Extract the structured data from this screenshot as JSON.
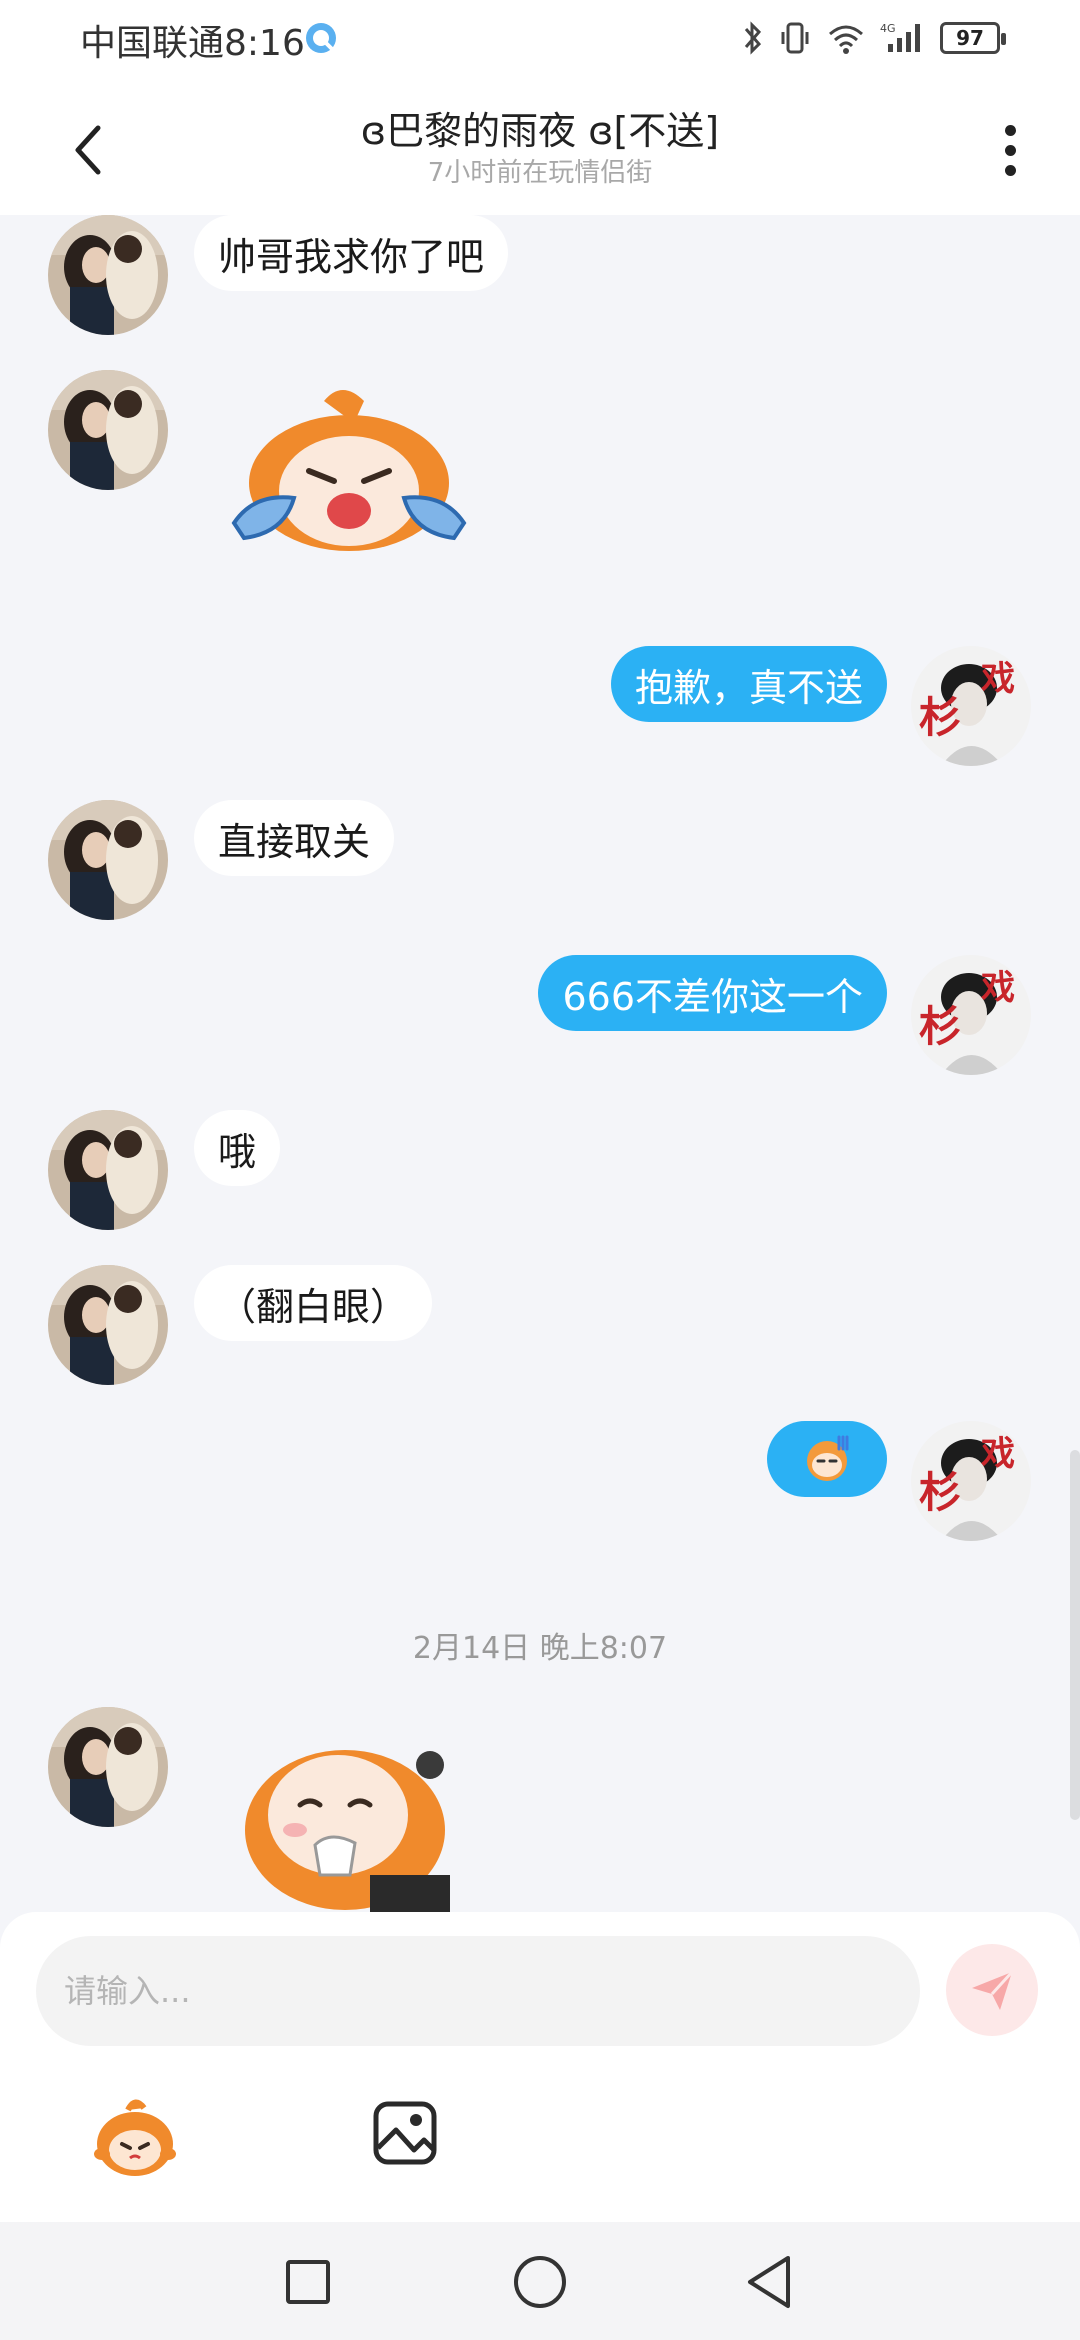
{
  "status_bar": {
    "carrier_time": "中国联通8:16",
    "network": "4G",
    "battery": "97"
  },
  "header": {
    "title": "ɞ巴黎的雨夜 ɞ[不送]",
    "subtitle": "7小时前在玩情侣街"
  },
  "messages": [
    {
      "from": "other",
      "type": "text",
      "text": "帅哥我求你了吧"
    },
    {
      "from": "other",
      "type": "sticker",
      "sticker": "crying-fox-sticker"
    },
    {
      "from": "me",
      "type": "text",
      "text": "抱歉，真不送"
    },
    {
      "from": "other",
      "type": "text",
      "text": "直接取关"
    },
    {
      "from": "me",
      "type": "text",
      "text": "666不差你这一个"
    },
    {
      "from": "other",
      "type": "text",
      "text": "哦"
    },
    {
      "from": "other",
      "type": "text",
      "text": "（翻白眼）"
    },
    {
      "from": "me",
      "type": "emoji",
      "emoji": "face-emoji"
    },
    {
      "from": "other",
      "type": "sticker",
      "sticker": "tissue-fox-sticker"
    }
  ],
  "timestamp": "2月14日 晚上8:07",
  "input": {
    "placeholder": "请输入..."
  },
  "colors": {
    "outgoing_bubble": "#2bb1f4",
    "incoming_bubble": "#ffffff",
    "background": "#f4f5f9",
    "send_button": "#fde8e8"
  }
}
